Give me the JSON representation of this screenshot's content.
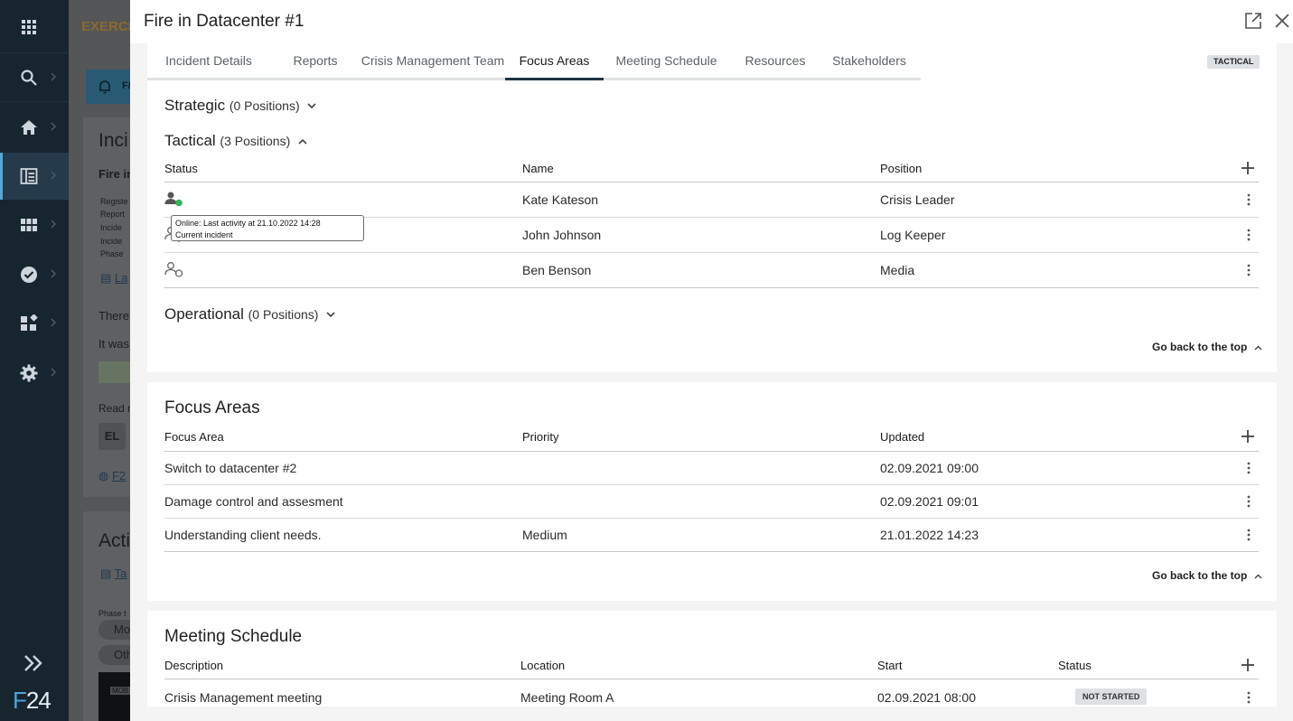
{
  "background": {
    "exercise_banner": "EXERCIS",
    "bell_label": "F/",
    "heading1": "Inci",
    "subheading": "Fire in",
    "meta_lines": [
      "Registe",
      "Report",
      "Incide",
      "Incide",
      "Phase"
    ],
    "link1": "La",
    "text1": "There",
    "text2": "It was",
    "read_label": "Read r",
    "chip": "EL",
    "link2": "F2",
    "heading2": "Acti",
    "link3": "Ta",
    "phase_label": "Phase t",
    "pill1": "Mo",
    "pill2": "Oth",
    "thumb_label": "MOB"
  },
  "nav": {
    "items": [
      {
        "name": "apps",
        "icon": "grid-icon"
      },
      {
        "name": "search",
        "icon": "search-icon"
      },
      {
        "name": "home",
        "icon": "home-icon"
      },
      {
        "name": "incidents",
        "icon": "dashboard-icon",
        "active": true
      },
      {
        "name": "modules",
        "icon": "apps-icon"
      },
      {
        "name": "tasks",
        "icon": "check-circle-icon"
      },
      {
        "name": "widgets",
        "icon": "widgets-icon"
      },
      {
        "name": "settings",
        "icon": "gear-icon"
      }
    ],
    "logo_left": "F",
    "logo_right": "24"
  },
  "dialog": {
    "title": "Fire in Datacenter #1",
    "tabs": [
      {
        "label": "Incident Details"
      },
      {
        "label": "Reports"
      },
      {
        "label": "Crisis Management Team"
      },
      {
        "label": "Focus Areas",
        "active": true
      },
      {
        "label": "Meeting Schedule"
      },
      {
        "label": "Resources"
      },
      {
        "label": "Stakeholders"
      }
    ],
    "phase_badge": "TACTICAL"
  },
  "team": {
    "strategic": {
      "label": "Strategic",
      "count": "(0 Positions)"
    },
    "tactical": {
      "label": "Tactical",
      "count": "(3 Positions)"
    },
    "operational": {
      "label": "Operational",
      "count": "(0 Positions)"
    },
    "columns": {
      "status": "Status",
      "name": "Name",
      "position": "Position"
    },
    "rows": [
      {
        "name": "Kate Kateson",
        "position": "Crisis Leader",
        "status": "online"
      },
      {
        "name": "John Johnson",
        "position": "Log Keeper",
        "status": "offline"
      },
      {
        "name": "Ben Benson",
        "position": "Media",
        "status": "offline"
      }
    ],
    "tooltip": {
      "line1": "Online: Last activity at 21.10.2022 14:28",
      "line2": "Current incident"
    },
    "back_to_top": "Go back to the top"
  },
  "focus_areas": {
    "title": "Focus Areas",
    "columns": {
      "area": "Focus Area",
      "priority": "Priority",
      "updated": "Updated"
    },
    "rows": [
      {
        "area": "Switch to datacenter #2",
        "priority": "",
        "updated": "02.09.2021 09:00"
      },
      {
        "area": "Damage control and assesment",
        "priority": "",
        "updated": "02.09.2021 09:01"
      },
      {
        "area": "Understanding client needs.",
        "priority": "Medium",
        "updated": "21.01.2022 14:23"
      }
    ],
    "back_to_top": "Go back to the top"
  },
  "meetings": {
    "title": "Meeting Schedule",
    "columns": {
      "description": "Description",
      "location": "Location",
      "start": "Start",
      "status": "Status"
    },
    "rows": [
      {
        "description": "Crisis Management meeting",
        "location": "Meeting Room A",
        "start": "02.09.2021 08:00",
        "status": "NOT STARTED"
      }
    ]
  },
  "colors": {
    "rail": "#17252f",
    "accent": "#5aa5d6",
    "online": "#2fb55a",
    "tab_active": "#1f3444"
  }
}
